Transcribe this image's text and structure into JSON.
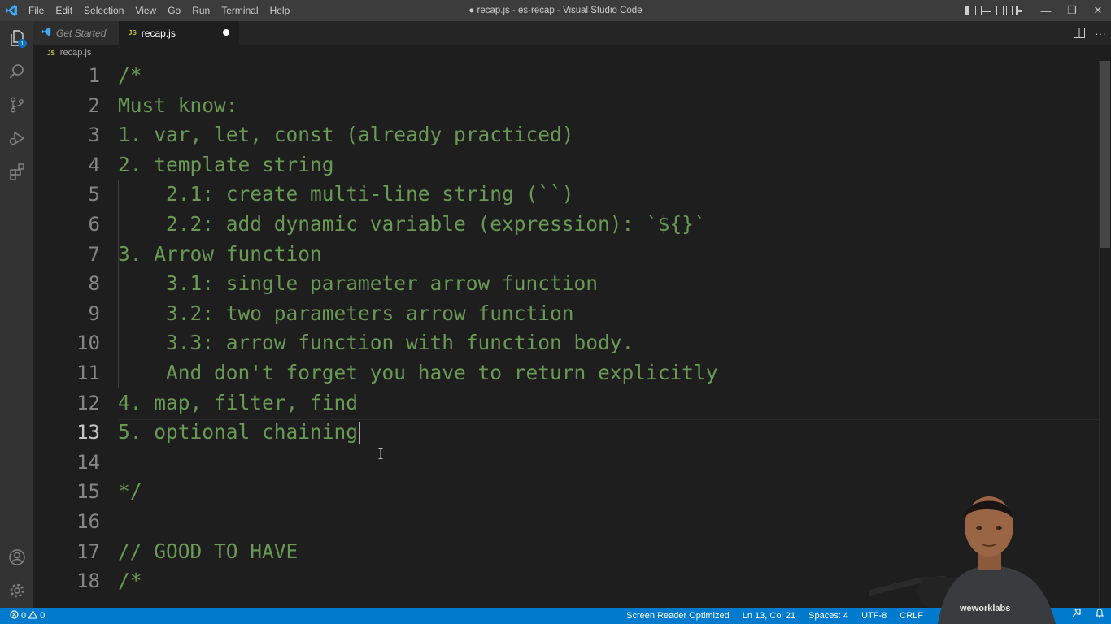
{
  "window": {
    "title": "● recap.js - es-recap - Visual Studio Code"
  },
  "menu": [
    "File",
    "Edit",
    "Selection",
    "View",
    "Go",
    "Run",
    "Terminal",
    "Help"
  ],
  "window_controls": {
    "minimize": "—",
    "restore": "❐",
    "close": "✕"
  },
  "activity_bar": {
    "explorer_badge": "1",
    "icons": [
      "files-icon",
      "search-icon",
      "source-control-icon",
      "run-debug-icon",
      "extensions-icon",
      "account-icon",
      "settings-gear-icon"
    ]
  },
  "tabs": [
    {
      "label": "Get Started",
      "active": false
    },
    {
      "label": "recap.js",
      "active": true,
      "modified": true,
      "lang_badge": "JS"
    }
  ],
  "breadcrumb": {
    "lang_badge": "JS",
    "file": "recap.js"
  },
  "editor": {
    "current_line": 13,
    "lines": [
      {
        "n": "1",
        "text": "/*"
      },
      {
        "n": "2",
        "text": "Must know:"
      },
      {
        "n": "3",
        "text": "1. var, let, const (already practiced)"
      },
      {
        "n": "4",
        "text": "2. template string"
      },
      {
        "n": "5",
        "text": "    2.1: create multi-line string (``)"
      },
      {
        "n": "6",
        "text": "    2.2: add dynamic variable (expression): `${}`"
      },
      {
        "n": "7",
        "text": "3. Arrow function"
      },
      {
        "n": "8",
        "text": "    3.1: single parameter arrow function"
      },
      {
        "n": "9",
        "text": "    3.2: two parameters arrow function"
      },
      {
        "n": "10",
        "text": "    3.3: arrow function with function body."
      },
      {
        "n": "11",
        "text": "    And don't forget you have to return explicitly"
      },
      {
        "n": "12",
        "text": "4. map, filter, find"
      },
      {
        "n": "13",
        "text": "5. optional chaining"
      },
      {
        "n": "14",
        "text": ""
      },
      {
        "n": "15",
        "text": "*/"
      },
      {
        "n": "16",
        "text": ""
      },
      {
        "n": "17",
        "text": "// GOOD TO HAVE"
      },
      {
        "n": "18",
        "text": "/*"
      }
    ]
  },
  "status_bar": {
    "errors": "0",
    "warnings": "0",
    "screen_reader": "Screen Reader Optimized",
    "position": "Ln 13, Col 21",
    "spaces": "Spaces: 4",
    "encoding": "UTF-8",
    "eol": "CRLF"
  },
  "webcam": {
    "shirt_text": "weworklabs"
  },
  "colors": {
    "comment": "#6a9955",
    "status_bar": "#007acc",
    "editor_bg": "#1e1e1e"
  }
}
